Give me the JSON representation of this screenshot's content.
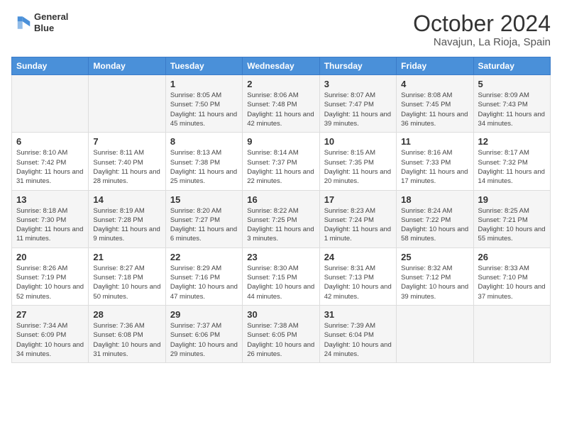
{
  "header": {
    "logo_line1": "General",
    "logo_line2": "Blue",
    "month_title": "October 2024",
    "location": "Navajun, La Rioja, Spain"
  },
  "weekdays": [
    "Sunday",
    "Monday",
    "Tuesday",
    "Wednesday",
    "Thursday",
    "Friday",
    "Saturday"
  ],
  "weeks": [
    [
      {
        "day": "",
        "info": ""
      },
      {
        "day": "",
        "info": ""
      },
      {
        "day": "1",
        "info": "Sunrise: 8:05 AM\nSunset: 7:50 PM\nDaylight: 11 hours and 45 minutes."
      },
      {
        "day": "2",
        "info": "Sunrise: 8:06 AM\nSunset: 7:48 PM\nDaylight: 11 hours and 42 minutes."
      },
      {
        "day": "3",
        "info": "Sunrise: 8:07 AM\nSunset: 7:47 PM\nDaylight: 11 hours and 39 minutes."
      },
      {
        "day": "4",
        "info": "Sunrise: 8:08 AM\nSunset: 7:45 PM\nDaylight: 11 hours and 36 minutes."
      },
      {
        "day": "5",
        "info": "Sunrise: 8:09 AM\nSunset: 7:43 PM\nDaylight: 11 hours and 34 minutes."
      }
    ],
    [
      {
        "day": "6",
        "info": "Sunrise: 8:10 AM\nSunset: 7:42 PM\nDaylight: 11 hours and 31 minutes."
      },
      {
        "day": "7",
        "info": "Sunrise: 8:11 AM\nSunset: 7:40 PM\nDaylight: 11 hours and 28 minutes."
      },
      {
        "day": "8",
        "info": "Sunrise: 8:13 AM\nSunset: 7:38 PM\nDaylight: 11 hours and 25 minutes."
      },
      {
        "day": "9",
        "info": "Sunrise: 8:14 AM\nSunset: 7:37 PM\nDaylight: 11 hours and 22 minutes."
      },
      {
        "day": "10",
        "info": "Sunrise: 8:15 AM\nSunset: 7:35 PM\nDaylight: 11 hours and 20 minutes."
      },
      {
        "day": "11",
        "info": "Sunrise: 8:16 AM\nSunset: 7:33 PM\nDaylight: 11 hours and 17 minutes."
      },
      {
        "day": "12",
        "info": "Sunrise: 8:17 AM\nSunset: 7:32 PM\nDaylight: 11 hours and 14 minutes."
      }
    ],
    [
      {
        "day": "13",
        "info": "Sunrise: 8:18 AM\nSunset: 7:30 PM\nDaylight: 11 hours and 11 minutes."
      },
      {
        "day": "14",
        "info": "Sunrise: 8:19 AM\nSunset: 7:28 PM\nDaylight: 11 hours and 9 minutes."
      },
      {
        "day": "15",
        "info": "Sunrise: 8:20 AM\nSunset: 7:27 PM\nDaylight: 11 hours and 6 minutes."
      },
      {
        "day": "16",
        "info": "Sunrise: 8:22 AM\nSunset: 7:25 PM\nDaylight: 11 hours and 3 minutes."
      },
      {
        "day": "17",
        "info": "Sunrise: 8:23 AM\nSunset: 7:24 PM\nDaylight: 11 hours and 1 minute."
      },
      {
        "day": "18",
        "info": "Sunrise: 8:24 AM\nSunset: 7:22 PM\nDaylight: 10 hours and 58 minutes."
      },
      {
        "day": "19",
        "info": "Sunrise: 8:25 AM\nSunset: 7:21 PM\nDaylight: 10 hours and 55 minutes."
      }
    ],
    [
      {
        "day": "20",
        "info": "Sunrise: 8:26 AM\nSunset: 7:19 PM\nDaylight: 10 hours and 52 minutes."
      },
      {
        "day": "21",
        "info": "Sunrise: 8:27 AM\nSunset: 7:18 PM\nDaylight: 10 hours and 50 minutes."
      },
      {
        "day": "22",
        "info": "Sunrise: 8:29 AM\nSunset: 7:16 PM\nDaylight: 10 hours and 47 minutes."
      },
      {
        "day": "23",
        "info": "Sunrise: 8:30 AM\nSunset: 7:15 PM\nDaylight: 10 hours and 44 minutes."
      },
      {
        "day": "24",
        "info": "Sunrise: 8:31 AM\nSunset: 7:13 PM\nDaylight: 10 hours and 42 minutes."
      },
      {
        "day": "25",
        "info": "Sunrise: 8:32 AM\nSunset: 7:12 PM\nDaylight: 10 hours and 39 minutes."
      },
      {
        "day": "26",
        "info": "Sunrise: 8:33 AM\nSunset: 7:10 PM\nDaylight: 10 hours and 37 minutes."
      }
    ],
    [
      {
        "day": "27",
        "info": "Sunrise: 7:34 AM\nSunset: 6:09 PM\nDaylight: 10 hours and 34 minutes."
      },
      {
        "day": "28",
        "info": "Sunrise: 7:36 AM\nSunset: 6:08 PM\nDaylight: 10 hours and 31 minutes."
      },
      {
        "day": "29",
        "info": "Sunrise: 7:37 AM\nSunset: 6:06 PM\nDaylight: 10 hours and 29 minutes."
      },
      {
        "day": "30",
        "info": "Sunrise: 7:38 AM\nSunset: 6:05 PM\nDaylight: 10 hours and 26 minutes."
      },
      {
        "day": "31",
        "info": "Sunrise: 7:39 AM\nSunset: 6:04 PM\nDaylight: 10 hours and 24 minutes."
      },
      {
        "day": "",
        "info": ""
      },
      {
        "day": "",
        "info": ""
      }
    ]
  ]
}
